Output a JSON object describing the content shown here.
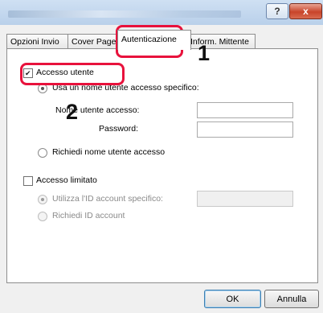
{
  "window": {
    "help_label": "?",
    "close_label": "x"
  },
  "tabs": [
    {
      "label": "Opzioni Invio"
    },
    {
      "label": "Cover Page"
    },
    {
      "label": "Autenticazione"
    },
    {
      "label": "Inform. Mittente"
    }
  ],
  "auth": {
    "user_access_label": "Accesso utente",
    "use_specific_label": "Usa un nome utente accesso specifico:",
    "login_name_label": "Nome utente accesso:",
    "password_label": "Password:",
    "ask_name_label": "Richiedi nome utente accesso",
    "limited_access_label": "Accesso limitato",
    "use_account_id_label": "Utilizza l'ID account specifico:",
    "ask_account_id_label": "Richiedi ID account",
    "login_name_value": "",
    "password_value": "",
    "account_id_value": ""
  },
  "callouts": {
    "step1": "1",
    "step2": "2"
  },
  "buttons": {
    "ok": "OK",
    "cancel": "Annulla"
  },
  "colors": {
    "highlight": "#e8123c"
  }
}
